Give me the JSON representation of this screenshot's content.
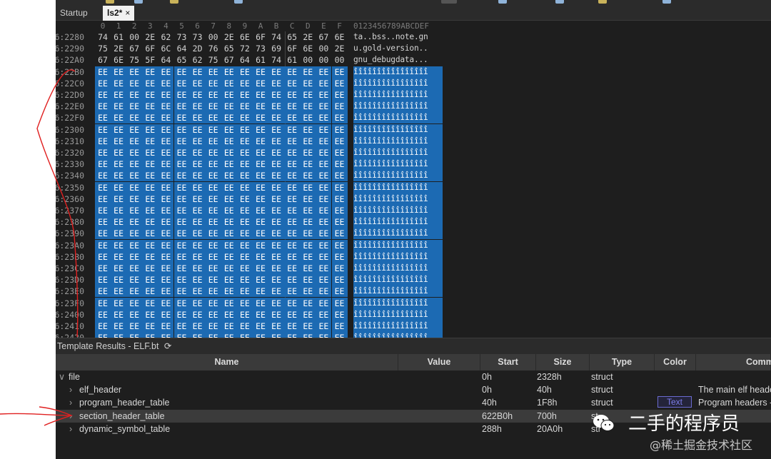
{
  "tabs": [
    {
      "label": "Startup",
      "active": false
    },
    {
      "label": "ls2*",
      "active": true,
      "close": "×"
    }
  ],
  "hex": {
    "columns": [
      "0",
      "1",
      "2",
      "3",
      "4",
      "5",
      "6",
      "7",
      "8",
      "9",
      "A",
      "B",
      "C",
      "D",
      "E",
      "F"
    ],
    "ascii_header": "0123456789ABCDEF",
    "rows": [
      {
        "addr": "6:2280",
        "bytes": [
          "74",
          "61",
          "00",
          "2E",
          "62",
          "73",
          "73",
          "00",
          "2E",
          "6E",
          "6F",
          "74",
          "65",
          "2E",
          "67",
          "6E"
        ],
        "ascii": "ta..bss..note.gn",
        "sel_from": 16
      },
      {
        "addr": "6:2290",
        "bytes": [
          "75",
          "2E",
          "67",
          "6F",
          "6C",
          "64",
          "2D",
          "76",
          "65",
          "72",
          "73",
          "69",
          "6F",
          "6E",
          "00",
          "2E"
        ],
        "ascii": "u.gold-version..",
        "sel_from": 16
      },
      {
        "addr": "6:22A0",
        "bytes": [
          "67",
          "6E",
          "75",
          "5F",
          "64",
          "65",
          "62",
          "75",
          "67",
          "64",
          "61",
          "74",
          "61",
          "00",
          "00",
          "00"
        ],
        "ascii": "gnu_debugdata...",
        "sel_from": 16
      },
      {
        "addr": "6:22B0",
        "bytes": "EE",
        "ascii": "îîîîîîîîîîîîîîîî",
        "sel_from": 0
      },
      {
        "addr": "6:22C0",
        "bytes": "EE",
        "ascii": "îîîîîîîîîîîîîîîî",
        "sel_from": 0
      },
      {
        "addr": "6:22D0",
        "bytes": "EE",
        "ascii": "îîîîîîîîîîîîîîîî",
        "sel_from": 0
      },
      {
        "addr": "6:22E0",
        "bytes": "EE",
        "ascii": "îîîîîîîîîîîîîîîî",
        "sel_from": 0
      },
      {
        "addr": "6:22F0",
        "bytes": "EE",
        "ascii": "îîîîîîîîîîîîîîîî",
        "sel_from": 0
      },
      {
        "addr": "6:2300",
        "bytes": "EE",
        "ascii": "îîîîîîîîîîîîîîîî",
        "sel_from": 0
      },
      {
        "addr": "6:2310",
        "bytes": "EE",
        "ascii": "îîîîîîîîîîîîîîîî",
        "sel_from": 0
      },
      {
        "addr": "6:2320",
        "bytes": "EE",
        "ascii": "îîîîîîîîîîîîîîîî",
        "sel_from": 0
      },
      {
        "addr": "6:2330",
        "bytes": "EE",
        "ascii": "îîîîîîîîîîîîîîîî",
        "sel_from": 0
      },
      {
        "addr": "6:2340",
        "bytes": "EE",
        "ascii": "îîîîîîîîîîîîîîîî",
        "sel_from": 0
      },
      {
        "addr": "6:2350",
        "bytes": "EE",
        "ascii": "îîîîîîîîîîîîîîîî",
        "sel_from": 0
      },
      {
        "addr": "6:2360",
        "bytes": "EE",
        "ascii": "îîîîîîîîîîîîîîîî",
        "sel_from": 0
      },
      {
        "addr": "6:2370",
        "bytes": "EE",
        "ascii": "îîîîîîîîîîîîîîîî",
        "sel_from": 0
      },
      {
        "addr": "6:2380",
        "bytes": "EE",
        "ascii": "îîîîîîîîîîîîîîîî",
        "sel_from": 0
      },
      {
        "addr": "6:2390",
        "bytes": "EE",
        "ascii": "îîîîîîîîîîîîîîîî",
        "sel_from": 0
      },
      {
        "addr": "6:23A0",
        "bytes": "EE",
        "ascii": "îîîîîîîîîîîîîîîî",
        "sel_from": 0
      },
      {
        "addr": "6:23B0",
        "bytes": "EE",
        "ascii": "îîîîîîîîîîîîîîîî",
        "sel_from": 0
      },
      {
        "addr": "6:23C0",
        "bytes": "EE",
        "ascii": "îîîîîîîîîîîîîîîî",
        "sel_from": 0
      },
      {
        "addr": "6:23D0",
        "bytes": "EE",
        "ascii": "îîîîîîîîîîîîîîîî",
        "sel_from": 0
      },
      {
        "addr": "6:23E0",
        "bytes": "EE",
        "ascii": "îîîîîîîîîîîîîîîî",
        "sel_from": 0
      },
      {
        "addr": "6:23F0",
        "bytes": "EE",
        "ascii": "îîîîîîîîîîîîîîîî",
        "sel_from": 0
      },
      {
        "addr": "6:2400",
        "bytes": "EE",
        "ascii": "îîîîîîîîîîîîîîîî",
        "sel_from": 0
      },
      {
        "addr": "6:2410",
        "bytes": "EE",
        "ascii": "îîîîîîîîîîîîîîîî",
        "sel_from": 0
      },
      {
        "addr": "6:2420",
        "bytes": "EE",
        "ascii": "îîîîîîîîîîîîîîîî",
        "sel_from": 0
      }
    ]
  },
  "template_results": {
    "title": "Template Results - ELF.bt",
    "refresh_icon": "refresh-icon",
    "columns": [
      "Name",
      "Value",
      "Start",
      "Size",
      "Type",
      "Color",
      "Comm"
    ],
    "rows": [
      {
        "name": "file",
        "expanded": true,
        "indent": 0,
        "value": "",
        "start": "0h",
        "size": "2328h",
        "type": "struct",
        "color": "",
        "comment": ""
      },
      {
        "name": "elf_header",
        "expanded": false,
        "indent": 1,
        "value": "",
        "start": "0h",
        "size": "40h",
        "type": "struct",
        "color": "",
        "comment": "The main elf heade"
      },
      {
        "name": "program_header_table",
        "expanded": false,
        "indent": 1,
        "value": "",
        "start": "40h",
        "size": "1F8h",
        "type": "struct",
        "color": "Text",
        "comment": "Program headers -"
      },
      {
        "name": "section_header_table",
        "expanded": false,
        "indent": 1,
        "value": "",
        "start": "622B0h",
        "size": "700h",
        "type": "st",
        "color": "",
        "comment": "",
        "highlighted": true
      },
      {
        "name": "dynamic_symbol_table",
        "expanded": false,
        "indent": 1,
        "value": "",
        "start": "288h",
        "size": "20A0h",
        "type": "str",
        "color": "",
        "comment": ""
      }
    ]
  },
  "watermark": {
    "title": "二手的程序员",
    "subtitle": "@稀土掘金技术社区"
  },
  "colors": {
    "selection": "#1c6ab3",
    "annotation": "#e02020",
    "background": "#1e1e1e"
  }
}
